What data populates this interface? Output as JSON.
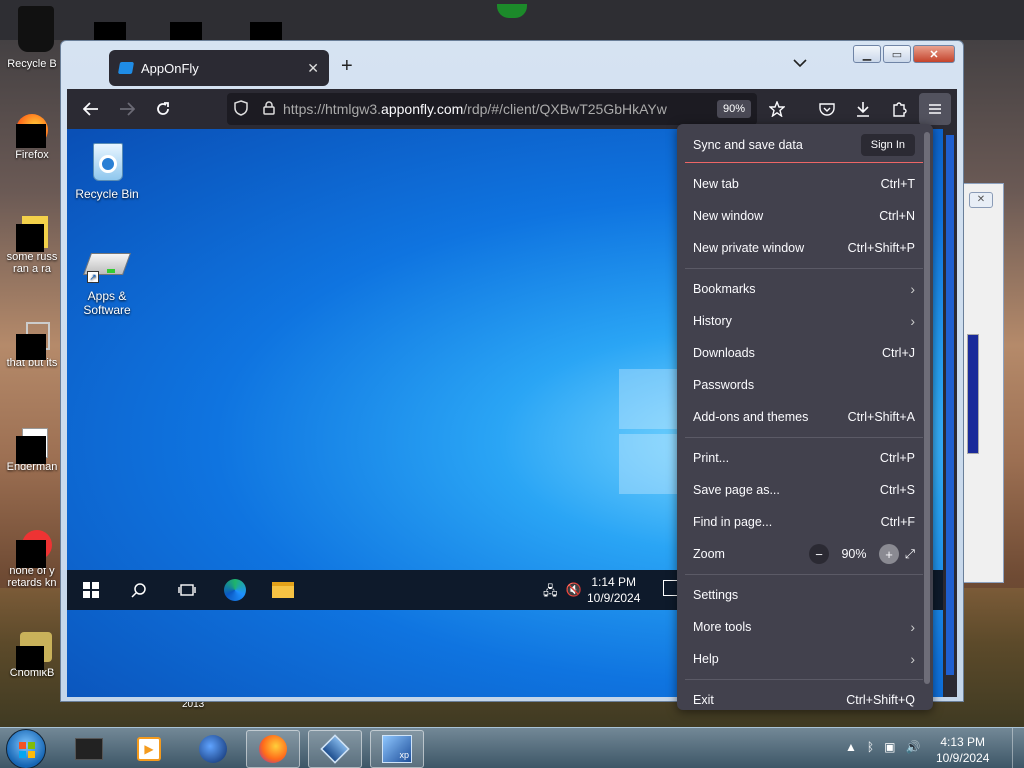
{
  "desktop": {
    "icons": [
      {
        "label": "Recycle B",
        "icon": "recycle-bin-icon"
      },
      {
        "label": "Firefox",
        "icon": "firefox-icon"
      },
      {
        "label": "some russ ran a ra",
        "icon": "file-icon"
      },
      {
        "label": "that but its",
        "icon": "file-icon"
      },
      {
        "label": "Enderman",
        "icon": "file-icon"
      },
      {
        "label": "none of y retards kn",
        "icon": "file-icon"
      },
      {
        "label": "ChomikB",
        "icon": "file-icon"
      }
    ],
    "stray_label": "2013"
  },
  "browser": {
    "tab": {
      "title": "AppOnFly",
      "close": "✕"
    },
    "new_tab": "+",
    "tab_list": "⌄",
    "url_prefix": "https://htmlgw3.",
    "url_domain": "apponfly.com",
    "url_rest": "/rdp/#/client/QXBwT25GbHkAYw",
    "zoom_badge": "90%",
    "window_buttons": {
      "minimize": "▁",
      "maximize": "▭",
      "close": "✕"
    }
  },
  "remote_desktop": {
    "icons": [
      {
        "label": "Recycle Bin"
      },
      {
        "label": "Apps & Software"
      }
    ],
    "clock_time": "1:14 PM",
    "clock_date": "10/9/2024"
  },
  "menu": {
    "sync_label": "Sync and save data",
    "sign_in": "Sign In",
    "items": [
      {
        "label": "New tab",
        "shortcut": "Ctrl+T"
      },
      {
        "label": "New window",
        "shortcut": "Ctrl+N"
      },
      {
        "label": "New private window",
        "shortcut": "Ctrl+Shift+P"
      },
      {
        "label": "Bookmarks",
        "shortcut": ""
      },
      {
        "label": "History",
        "shortcut": ""
      },
      {
        "label": "Downloads",
        "shortcut": "Ctrl+J"
      },
      {
        "label": "Passwords",
        "shortcut": ""
      },
      {
        "label": "Add-ons and themes",
        "shortcut": "Ctrl+Shift+A"
      },
      {
        "label": "Print...",
        "shortcut": "Ctrl+P"
      },
      {
        "label": "Save page as...",
        "shortcut": "Ctrl+S"
      },
      {
        "label": "Find in page...",
        "shortcut": "Ctrl+F"
      },
      {
        "label": "Zoom",
        "shortcut": ""
      },
      {
        "label": "Settings",
        "shortcut": ""
      },
      {
        "label": "More tools",
        "shortcut": ""
      },
      {
        "label": "Help",
        "shortcut": ""
      },
      {
        "label": "Exit",
        "shortcut": "Ctrl+Shift+Q"
      }
    ],
    "zoom_value": "90%",
    "zoom_minus": "−",
    "zoom_fullscreen": "⤢"
  },
  "taskbar": {
    "clock_time": "4:13 PM",
    "clock_date": "10/9/2024"
  }
}
